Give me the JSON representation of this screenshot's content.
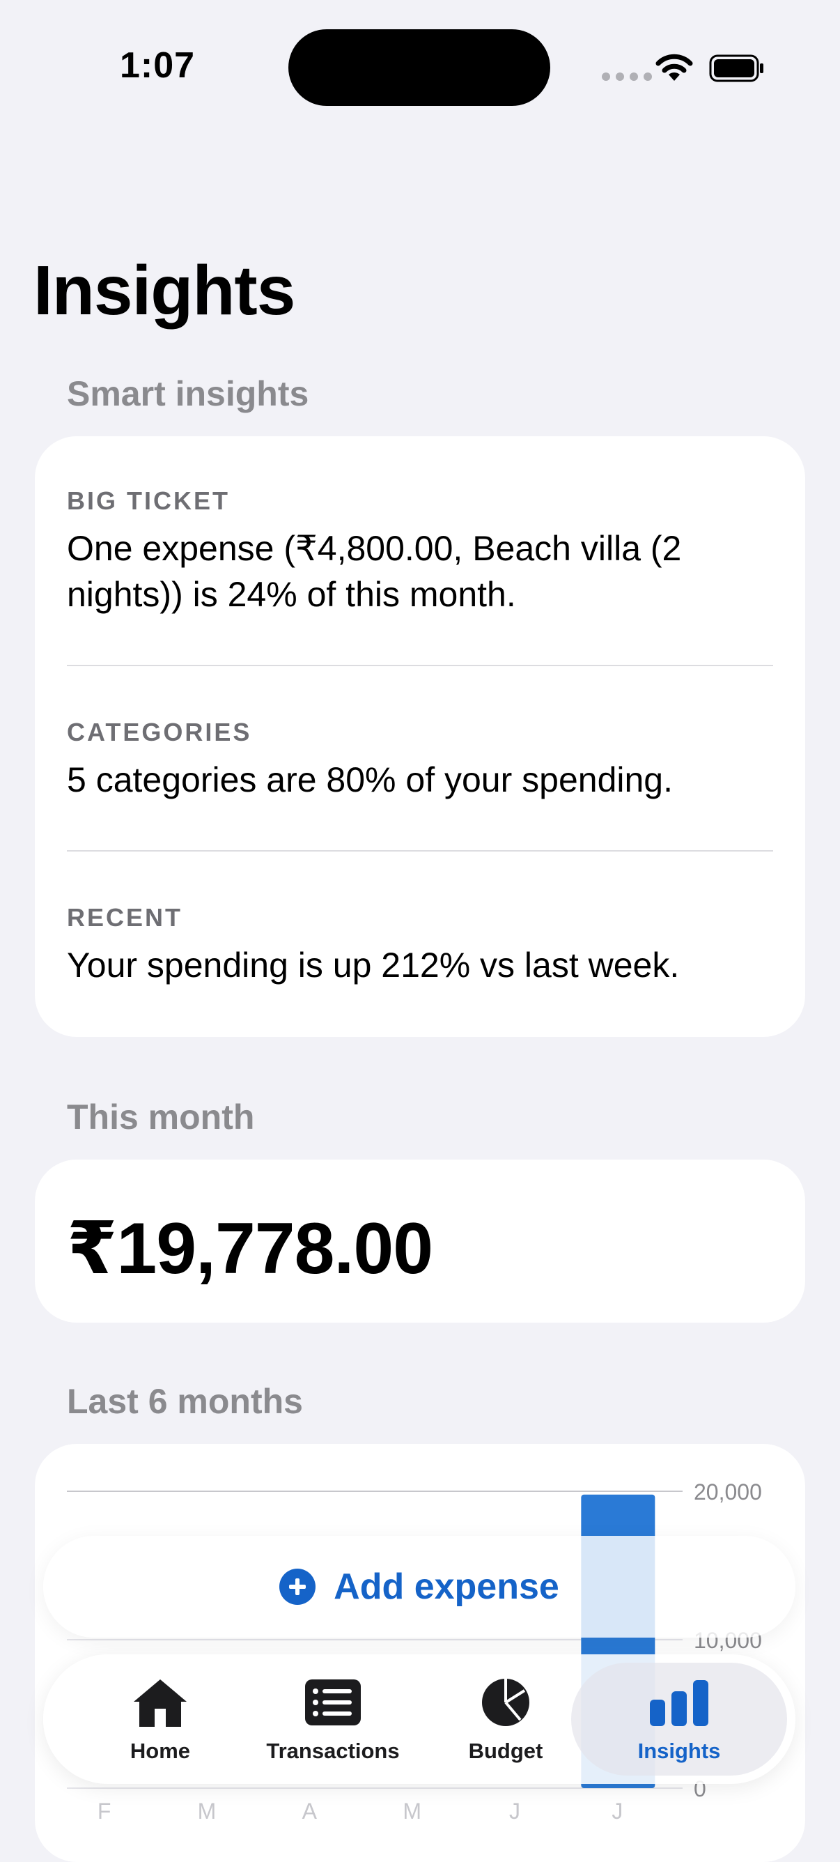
{
  "status_bar": {
    "time": "1:07"
  },
  "page": {
    "title": "Insights"
  },
  "smart_insights": {
    "header": "Smart insights",
    "items": [
      {
        "label": "BIG TICKET",
        "text": "One expense (₹4,800.00, Beach villa (2 nights)) is 24% of this month."
      },
      {
        "label": "CATEGORIES",
        "text": "5 categories are 80% of your spending."
      },
      {
        "label": "RECENT",
        "text": "Your spending is up 212% vs last week."
      }
    ]
  },
  "this_month": {
    "header": "This month",
    "amount": "₹19,778.00"
  },
  "last_6_months": {
    "header": "Last 6 months"
  },
  "chart_data": {
    "type": "bar",
    "categories": [
      "F",
      "M",
      "A",
      "M",
      "J",
      "J"
    ],
    "values": [
      0,
      0,
      0,
      0,
      0,
      19778
    ],
    "ylim": [
      0,
      20000
    ],
    "y_ticks": [
      "20,000",
      "10,000",
      "0"
    ],
    "bar_color": "#2a7ad6",
    "grid": true
  },
  "add_expense": {
    "label": "Add expense"
  },
  "tab_bar": {
    "tabs": [
      {
        "label": "Home",
        "icon": "house-icon"
      },
      {
        "label": "Transactions",
        "icon": "list-icon"
      },
      {
        "label": "Budget",
        "icon": "pie-chart-icon"
      },
      {
        "label": "Insights",
        "icon": "bar-chart-icon",
        "active": true
      }
    ]
  },
  "colors": {
    "accent": "#1563c8",
    "background": "#f2f2f7",
    "card": "#ffffff",
    "secondary_text": "#8a8a8e"
  }
}
